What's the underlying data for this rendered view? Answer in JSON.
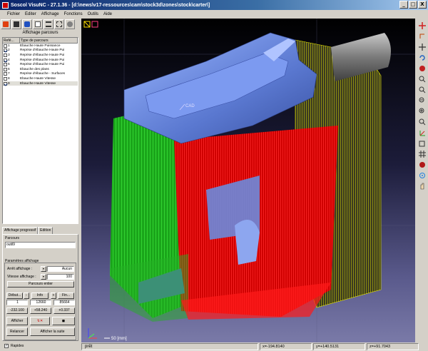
{
  "window": {
    "title": "Soscol VisuNC - 27.1.36 - [d:\\news\\v17-ressources\\cam\\stock3d\\zones\\stock\\carter\\]",
    "buttons": [
      "_",
      "□",
      "X"
    ]
  },
  "menu": [
    "Fichier",
    "Editer",
    "Affichage",
    "Fonctions",
    "Outils",
    "Aide"
  ],
  "left_panel": {
    "group_title": "Affichage parcours",
    "columns": [
      "Refé...",
      "Type de parcours"
    ],
    "items": [
      {
        "num": "1",
        "label": "Ebauche Haute Puissance",
        "checked": false
      },
      {
        "num": "2",
        "label": "Reprise d'ébauche Haute Pui",
        "checked": true
      },
      {
        "num": "3",
        "label": "Reprise d'ébauche Haute Pui",
        "checked": false
      },
      {
        "num": "4",
        "label": "Reprise d'ébauche Haute Pui",
        "checked": true
      },
      {
        "num": "5",
        "label": "Reprise d'ébauche Haute Pui",
        "checked": false
      },
      {
        "num": "6",
        "label": "Ebauche des plans",
        "checked": false
      },
      {
        "num": "7",
        "label": "Reprise d'ébauche - Surfaces",
        "checked": false
      },
      {
        "num": "8",
        "label": "Ebauche Haute Vitesse",
        "checked": false
      },
      {
        "num": "9",
        "label": "Ebauche Haute Vitesse",
        "checked": true
      }
    ],
    "tabs": [
      "Affichage progressif",
      "Edition"
    ],
    "parcours_label": "Parcours",
    "parcours_value": "outil9",
    "params_label": "Paramètres affichage",
    "arret_label": "Arrêt affichage :",
    "arret_value": "Aucun",
    "vitesse_label": "Vitesse affichage :",
    "vitesse_value": "100",
    "parcours_entier": "Parcours entier",
    "debut_label": "Début...",
    "info_label": "Info",
    "fin_label": "Fin...",
    "debut_value": "1",
    "info_value": "12660",
    "fin_value": "85664",
    "x_value": "-232.100",
    "y_value": "+58.240",
    "z_value": "+0.337",
    "afficher": "Afficher",
    "relancer": "Relancer",
    "afficher_suite": "Afficher la suite",
    "rapides": "Rapides",
    "rapides_checked": true
  },
  "viewport": {
    "cad_label": "CAD",
    "scale_label": "50 [mm]",
    "colors": {
      "green": "#22cc22",
      "red": "#ff1010",
      "yellow": "#e8e800",
      "part": "#6f8fe0"
    }
  },
  "status": {
    "ready": "prêt",
    "x": "x=-194.8140",
    "y": "y=+140.5131",
    "z": "z=+91.7043"
  }
}
